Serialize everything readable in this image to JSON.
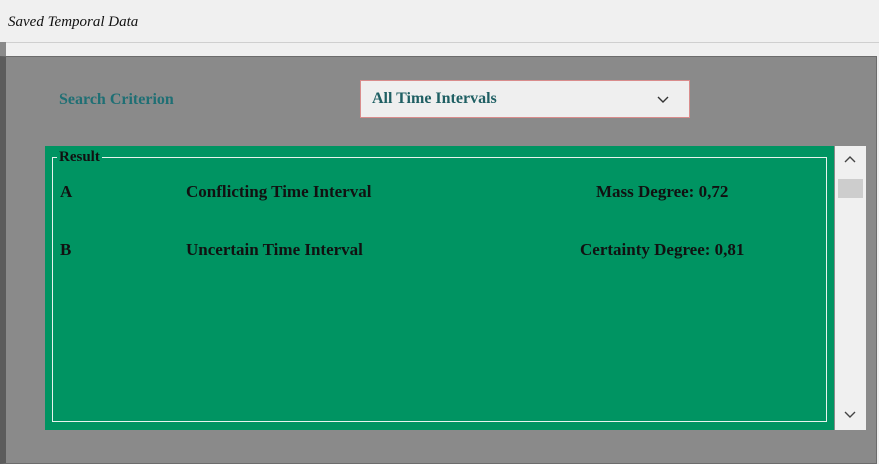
{
  "window": {
    "title": "Saved Temporal Data"
  },
  "search": {
    "label": "Search Criterion",
    "selected": "All Time Intervals"
  },
  "result": {
    "legend": "Result",
    "rows": [
      {
        "id": "A",
        "name": "Conflicting Time Interval",
        "metric": "Mass Degree: 0,72"
      },
      {
        "id": "B",
        "name": "Uncertain Time Interval",
        "metric": "Certainty Degree: 0,81"
      }
    ]
  },
  "icons": {
    "dropdown": "chevron-down-icon",
    "scroll_up": "chevron-up-icon",
    "scroll_down": "chevron-down-icon"
  },
  "colors": {
    "panel": "#8a8a8a",
    "result_bg": "#009462",
    "label": "#1f6f74",
    "select_border": "#d98c8c"
  }
}
